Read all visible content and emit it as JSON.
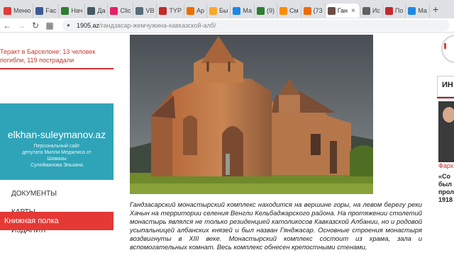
{
  "browser": {
    "tabs": [
      {
        "label": "Меню",
        "color": "#e53935"
      },
      {
        "label": "Fac",
        "color": "#3b5998"
      },
      {
        "label": "Нач",
        "color": "#2e7d32"
      },
      {
        "label": "Да",
        "color": "#455a64"
      },
      {
        "label": "Clic",
        "color": "#e91e63"
      },
      {
        "label": "VB",
        "color": "#546e7a"
      },
      {
        "label": "TYP",
        "color": "#c62828"
      },
      {
        "label": "Ар",
        "color": "#ef6c00"
      },
      {
        "label": "Бы",
        "color": "#f9a825"
      },
      {
        "label": "Ма",
        "color": "#1e88e5"
      },
      {
        "label": "(9)",
        "color": "#2e7d32"
      },
      {
        "label": "См",
        "color": "#fb8c00"
      },
      {
        "label": "(73",
        "color": "#ef6c00"
      },
      {
        "label": "Ган",
        "color": "#6d4c41"
      },
      {
        "label": "Ис",
        "color": "#616161"
      },
      {
        "label": "По",
        "color": "#c62828"
      },
      {
        "label": "Ма",
        "color": "#1e88e5"
      }
    ],
    "active_tab_index": 13,
    "new_tab": "+",
    "url_domain": "1905.az",
    "url_path": "/гандзасар-жемчужина-кавказской-алб/"
  },
  "left": {
    "news_line1": "Теракт в Барселоне: 13 человек",
    "news_line2": "погибли, 119 пострадали",
    "site_name": "elkhan-suleymanov.az",
    "site_desc": [
      "Персональный сайт",
      "депутата Милли Меджлиса от",
      "Шамахы",
      "Сулейманова Эльхана"
    ],
    "menu": [
      "ДОКУМЕНТЫ",
      "КАРТЫ",
      "ИЗДАНИЯ"
    ],
    "book_shelf": "Книжная полка"
  },
  "article": {
    "caption": "Гандзасарский монастырский комплекс находится на вершине горы, на левом берегу реки Хачын на территории селения Венгли Кельбаджарского района. На протяжении столетий монастырь являлся не только резиденцией католикосов Кавказской Албании, но и родовой усыпальницей албанских князей и был назван Гянджасар. Основные строения монастыря воздвигнуты в XIII веке. Монастырский комплекс состоит из храма, зала и вспомогательных комнат. Весь комплекс обнесен крепостными стенами,"
  },
  "right": {
    "box_label": "ИН",
    "person_name": "Фарх",
    "text_lines": [
      "«Со",
      "был",
      "прол",
      "1918"
    ]
  }
}
